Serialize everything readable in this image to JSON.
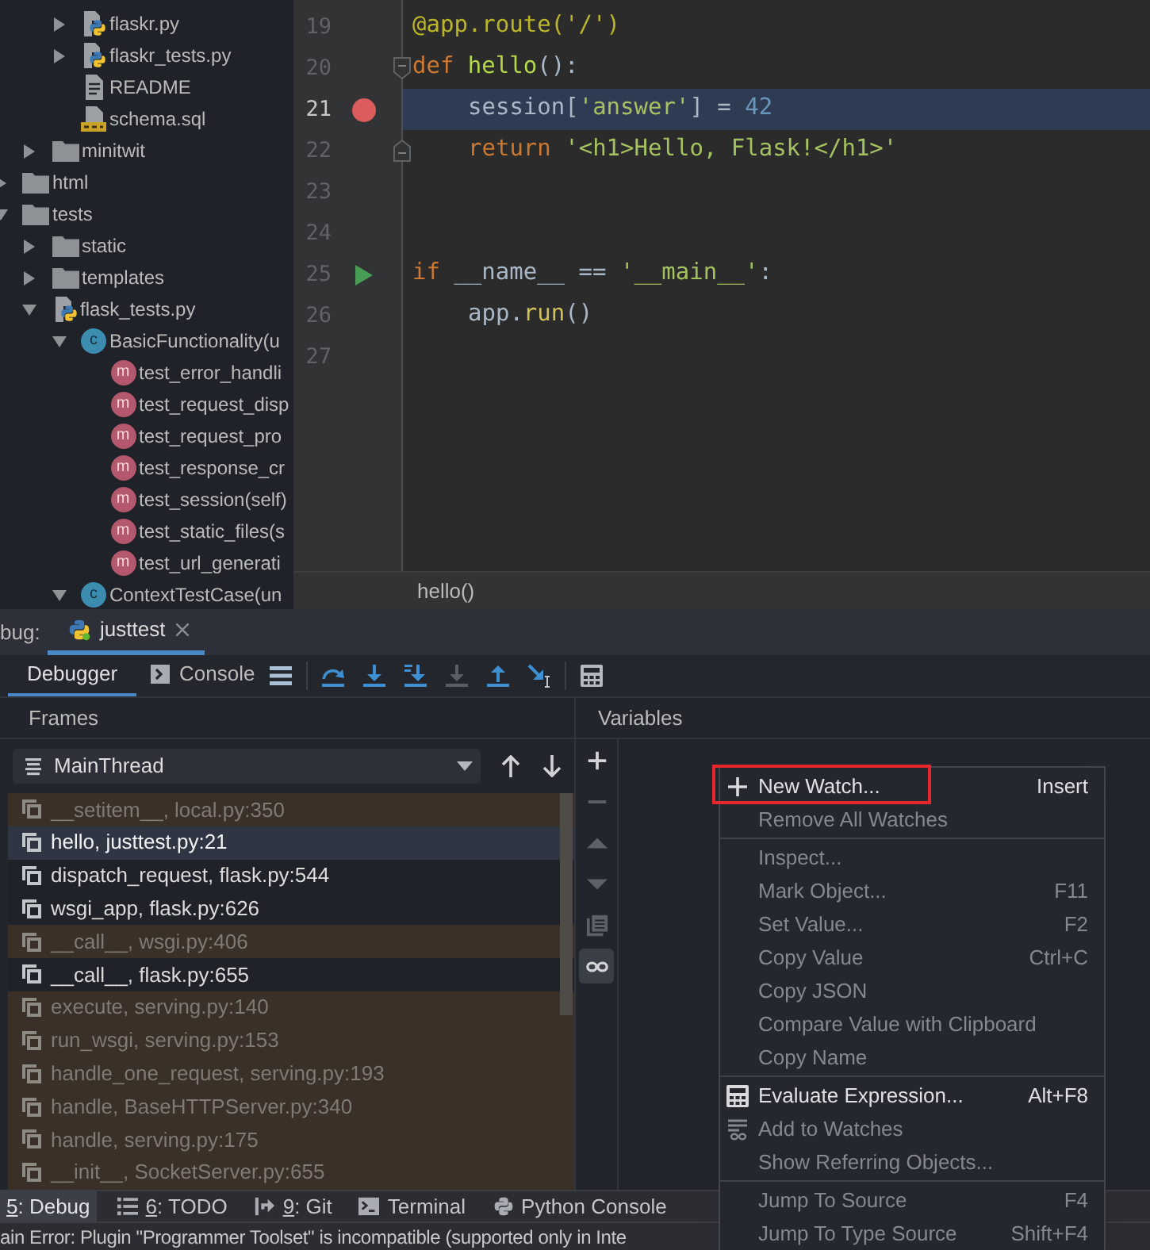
{
  "project_tree": {
    "items": [
      {
        "children": [
          {
            "children": [
              {
                "label": "flaskr.py",
                "kind": "python-file",
                "expanded": false
              },
              {
                "label": "flaskr_tests.py",
                "kind": "python-file",
                "expanded": false
              },
              {
                "label": "README",
                "kind": "text-file"
              },
              {
                "label": "schema.sql",
                "kind": "sql-file"
              }
            ]
          },
          {
            "label": "minitwit",
            "kind": "folder",
            "expanded": false
          }
        ]
      },
      {
        "label": "html",
        "kind": "folder",
        "expanded": false
      },
      {
        "label": "tests",
        "kind": "folder",
        "expanded": true,
        "children": [
          {
            "label": "static",
            "kind": "folder",
            "expanded": false
          },
          {
            "label": "templates",
            "kind": "folder",
            "expanded": false
          },
          {
            "label": "flask_tests.py",
            "kind": "python-file",
            "expanded": true,
            "children": [
              {
                "label": "BasicFunctionality(u",
                "kind": "class",
                "badge": "c",
                "expanded": true,
                "children": [
                  {
                    "label": "test_error_handli",
                    "kind": "method",
                    "badge": "m"
                  },
                  {
                    "label": "test_request_disp",
                    "kind": "method",
                    "badge": "m"
                  },
                  {
                    "label": "test_request_pro",
                    "kind": "method",
                    "badge": "m"
                  },
                  {
                    "label": "test_response_cr",
                    "kind": "method",
                    "badge": "m"
                  },
                  {
                    "label": "test_session(self)",
                    "kind": "method",
                    "badge": "m"
                  },
                  {
                    "label": "test_static_files(s",
                    "kind": "method",
                    "badge": "m"
                  },
                  {
                    "label": "test_url_generati",
                    "kind": "method",
                    "badge": "m"
                  }
                ]
              },
              {
                "label": "ContextTestCase(un",
                "kind": "class",
                "badge": "c",
                "expanded": true
              }
            ]
          }
        ]
      }
    ]
  },
  "editor": {
    "lines": [
      {
        "number": "19",
        "current": false,
        "indented": false,
        "tokens": [
          {
            "text": "@app.route('/')",
            "kind": "decorator"
          }
        ]
      },
      {
        "number": "20",
        "current": false,
        "indented": false,
        "fold": {
          "kind": "start"
        },
        "tokens": [
          {
            "text": "def",
            "kind": "keyword"
          },
          {
            "text": " hello",
            "kind": "function"
          },
          {
            "text": "():",
            "kind": "plain"
          }
        ]
      },
      {
        "number": "21",
        "current": true,
        "indented": true,
        "marker": {
          "kind": "breakpoint"
        },
        "tokens": [
          {
            "text": "session[",
            "kind": "plain"
          },
          {
            "text": "'answer'",
            "kind": "string"
          },
          {
            "text": "] = ",
            "kind": "plain"
          },
          {
            "text": "42",
            "kind": "number"
          }
        ]
      },
      {
        "number": "22",
        "current": false,
        "indented": true,
        "fold": {
          "kind": "end"
        },
        "tokens": [
          {
            "text": "return",
            "kind": "keyword"
          },
          {
            "text": " '<h1>Hello, Flask!</h1>'",
            "kind": "string"
          }
        ]
      },
      {
        "number": "23",
        "current": false
      },
      {
        "number": "24",
        "current": false
      },
      {
        "number": "25",
        "current": false,
        "indented": false,
        "marker": {
          "kind": "run"
        },
        "tokens": [
          {
            "text": "if",
            "kind": "keyword"
          },
          {
            "text": " __name__ == ",
            "kind": "plain"
          },
          {
            "text": "'__main__'",
            "kind": "string"
          },
          {
            "text": ":",
            "kind": "plain"
          }
        ]
      },
      {
        "number": "26",
        "current": false,
        "indented": true,
        "tokens": [
          {
            "text": "app.",
            "kind": "plain"
          },
          {
            "text": "run",
            "kind": "call"
          },
          {
            "text": "()",
            "kind": "plain"
          }
        ]
      },
      {
        "number": "27",
        "current": false
      }
    ],
    "breadcrumb": "hello()"
  },
  "debug": {
    "title": "bug:",
    "sessions": [
      {
        "label": "justtest",
        "selected": true
      }
    ],
    "tabs": [
      {
        "label": "Debugger",
        "selected": true
      },
      {
        "label": "Console",
        "selected": false
      }
    ],
    "actions": [
      {
        "disabled": false
      },
      {
        "disabled": false
      },
      {
        "disabled": false
      },
      {
        "disabled": false
      },
      {
        "disabled": true
      },
      {
        "disabled": false
      },
      {
        "disabled": false
      },
      {
        "disabled": false
      }
    ],
    "frames": {
      "title": "Frames",
      "thread": "MainThread",
      "rows": [
        {
          "label": "__setitem__, local.py:350",
          "library": true,
          "selected": false
        },
        {
          "label": "hello, justtest.py:21",
          "library": false,
          "selected": true
        },
        {
          "label": "dispatch_request, flask.py:544",
          "library": false,
          "selected": false
        },
        {
          "label": "wsgi_app, flask.py:626",
          "library": false,
          "selected": false
        },
        {
          "label": "__call__, wsgi.py:406",
          "library": true,
          "selected": false
        },
        {
          "label": "__call__, flask.py:655",
          "library": false,
          "selected": false
        },
        {
          "label": "execute, serving.py:140",
          "library": true,
          "selected": false
        },
        {
          "label": "run_wsgi, serving.py:153",
          "library": true,
          "selected": false
        },
        {
          "label": "handle_one_request, serving.py:193",
          "library": true,
          "selected": false
        },
        {
          "label": "handle, BaseHTTPServer.py:340",
          "library": true,
          "selected": false
        },
        {
          "label": "handle, serving.py:175",
          "library": true,
          "selected": false
        },
        {
          "label": "__init__, SocketServer.py:655",
          "library": true,
          "selected": false
        }
      ]
    },
    "variables": {
      "title": "Variables",
      "tools": [
        {
          "disabled": false,
          "selected": false
        },
        {
          "disabled": true,
          "selected": false
        },
        {
          "disabled": true,
          "selected": false
        },
        {
          "disabled": true,
          "selected": false
        },
        {
          "disabled": true,
          "selected": false
        },
        {
          "disabled": false,
          "selected": true
        }
      ]
    }
  },
  "context_menu": {
    "groups": [
      [
        {
          "label": "New Watch...",
          "shortcut": "Insert",
          "disabled": false,
          "annotated": true
        },
        {
          "label": "Remove All Watches",
          "disabled": true,
          "annotated": false
        }
      ],
      [
        {
          "label": "Inspect...",
          "disabled": true,
          "annotated": false
        },
        {
          "label": "Mark Object...",
          "shortcut": "F11",
          "disabled": true,
          "annotated": false
        },
        {
          "label": "Set Value...",
          "shortcut": "F2",
          "disabled": true,
          "annotated": false
        },
        {
          "label": "Copy Value",
          "shortcut": "Ctrl+C",
          "disabled": true,
          "annotated": false
        },
        {
          "label": "Copy JSON",
          "disabled": true,
          "annotated": false
        },
        {
          "label": "Compare Value with Clipboard",
          "disabled": true,
          "annotated": false
        },
        {
          "label": "Copy Name",
          "disabled": true,
          "annotated": false
        }
      ],
      [
        {
          "label": "Evaluate Expression...",
          "shortcut": "Alt+F8",
          "disabled": false,
          "annotated": false
        },
        {
          "label": "Add to Watches",
          "disabled": true,
          "annotated": false
        },
        {
          "label": "Show Referring Objects...",
          "disabled": true,
          "annotated": false
        }
      ],
      [
        {
          "label": "Jump To Source",
          "shortcut": "F4",
          "disabled": true,
          "annotated": false
        },
        {
          "label": "Jump To Type Source",
          "shortcut": "Shift+F4",
          "disabled": true,
          "annotated": false
        }
      ]
    ]
  },
  "tool_windows": [
    {
      "mnemonic": "5",
      "label": ": Debug",
      "selected": true
    },
    {
      "mnemonic": "6",
      "label": ": TODO",
      "selected": false
    },
    {
      "mnemonic": "9",
      "label": ": Git",
      "selected": false
    },
    {
      "label": "Terminal",
      "selected": false
    },
    {
      "label": "Python Console",
      "selected": false
    }
  ],
  "status_bar": {
    "message": "ain Error: Plugin \"Programmer Toolset\" is incompatible (supported only in Inte"
  }
}
